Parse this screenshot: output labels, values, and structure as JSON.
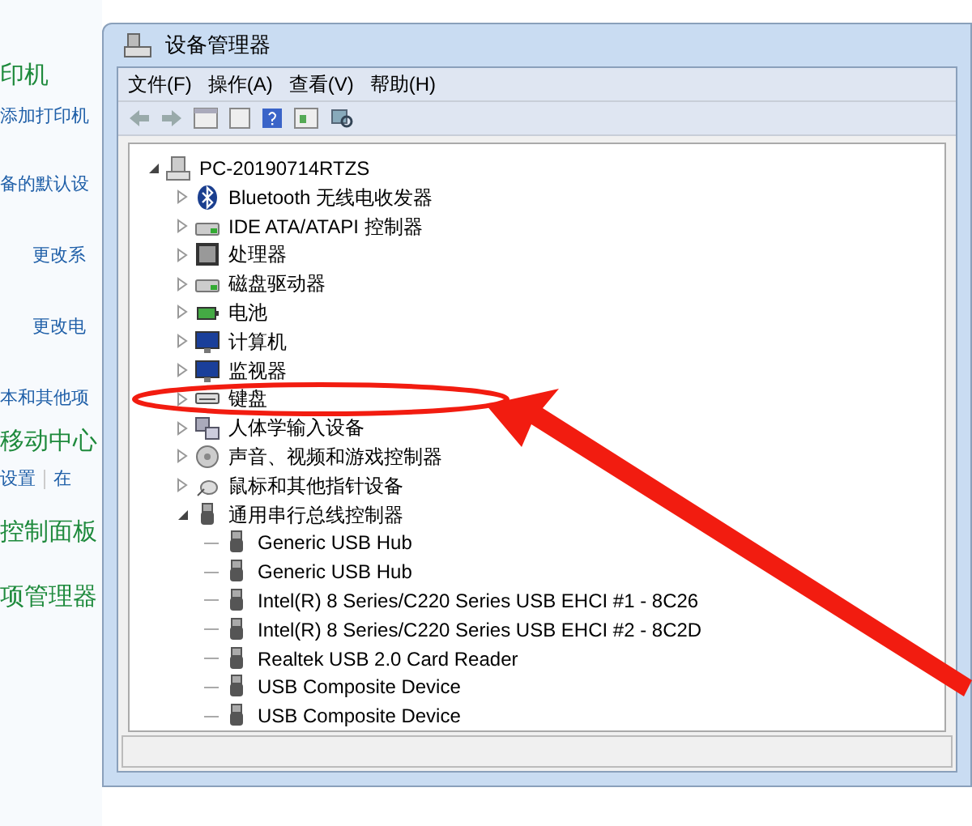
{
  "background_panel": {
    "items": [
      {
        "text": "印机",
        "kind": "heading"
      },
      {
        "text": "添加打印机",
        "kind": "link"
      },
      {
        "text": "备的默认设",
        "kind": "link"
      },
      {
        "text": "更改系",
        "kind": "link"
      },
      {
        "text": "更改电",
        "kind": "link"
      },
      {
        "text": "本和其他项",
        "kind": "link"
      },
      {
        "text": "移动中心",
        "kind": "heading"
      },
      {
        "text": "设置",
        "kind": "link"
      },
      {
        "text": "在",
        "kind": "link"
      },
      {
        "text": "控制面板",
        "kind": "heading"
      },
      {
        "text": "项管理器",
        "kind": "heading"
      }
    ]
  },
  "window": {
    "title": "设备管理器"
  },
  "menu": [
    "文件(F)",
    "操作(A)",
    "查看(V)",
    "帮助(H)"
  ],
  "tree": {
    "label": "PC-20190714RTZS",
    "kind": "computer",
    "expanded": true,
    "children": [
      {
        "label": "Bluetooth 无线电收发器",
        "kind": "bluetooth",
        "expanded": false
      },
      {
        "label": "IDE ATA/ATAPI 控制器",
        "kind": "drive",
        "expanded": false
      },
      {
        "label": "处理器",
        "kind": "cpu",
        "expanded": false
      },
      {
        "label": "磁盘驱动器",
        "kind": "drive",
        "expanded": false
      },
      {
        "label": "电池",
        "kind": "battery",
        "expanded": false
      },
      {
        "label": "计算机",
        "kind": "monitor",
        "expanded": false
      },
      {
        "label": "监视器",
        "kind": "monitor",
        "expanded": false
      },
      {
        "label": "键盘",
        "kind": "keyboard",
        "expanded": false
      },
      {
        "label": "人体学输入设备",
        "kind": "hid",
        "expanded": false
      },
      {
        "label": "声音、视频和游戏控制器",
        "kind": "sound",
        "expanded": false
      },
      {
        "label": "鼠标和其他指针设备",
        "kind": "mouse",
        "expanded": false
      },
      {
        "label": "通用串行总线控制器",
        "kind": "usb",
        "expanded": true,
        "children": [
          {
            "label": "Generic USB Hub",
            "kind": "usb"
          },
          {
            "label": "Generic USB Hub",
            "kind": "usb"
          },
          {
            "label": "Intel(R) 8 Series/C220 Series USB EHCI #1 - 8C26",
            "kind": "usb"
          },
          {
            "label": "Intel(R) 8 Series/C220 Series USB EHCI #2 - 8C2D",
            "kind": "usb"
          },
          {
            "label": "Realtek USB 2.0 Card Reader",
            "kind": "usb"
          },
          {
            "label": "USB Composite Device",
            "kind": "usb"
          },
          {
            "label": "USB Composite Device",
            "kind": "usb"
          }
        ]
      }
    ]
  }
}
